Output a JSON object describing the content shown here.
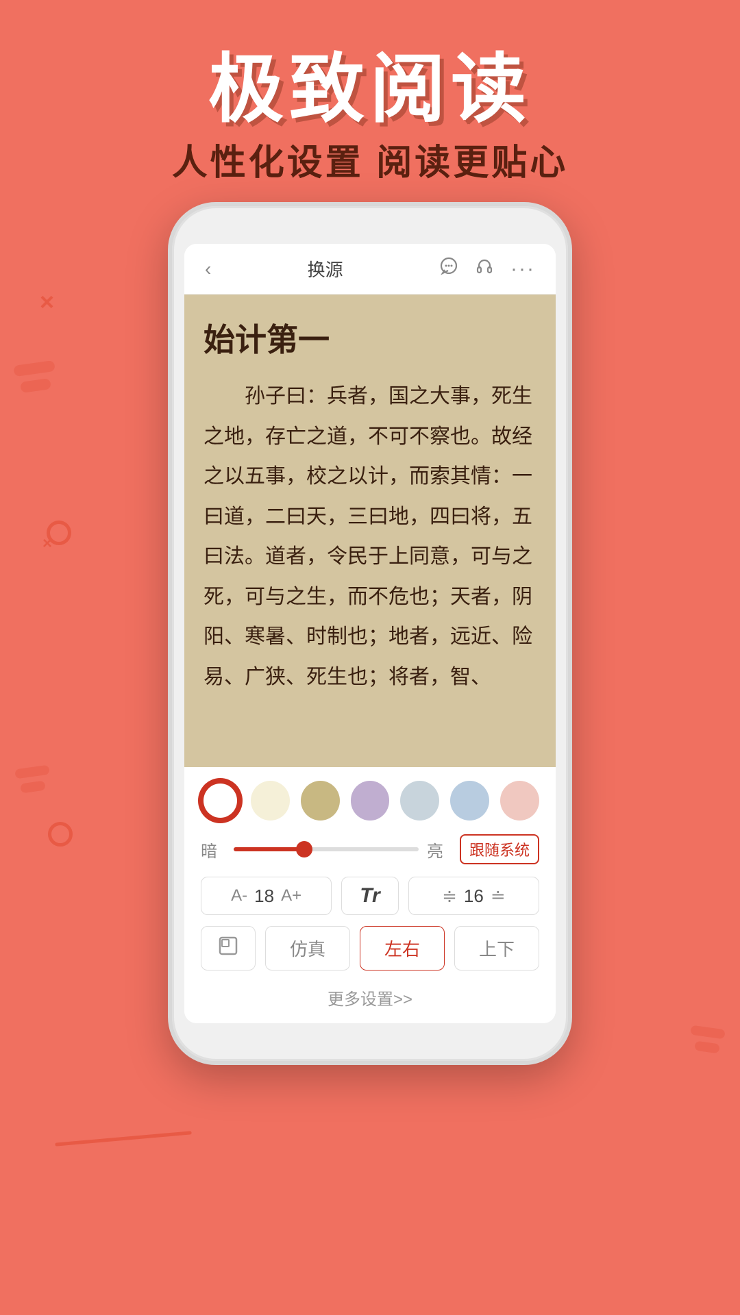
{
  "page": {
    "background_color": "#F07060",
    "main_title": "极致阅读",
    "subtitle": "人性化设置  阅读更贴心"
  },
  "phone": {
    "topbar": {
      "back_label": "‹",
      "title": "换源",
      "chat_icon": "💬",
      "headphone_icon": "🎧",
      "more_icon": "···"
    },
    "book": {
      "chapter_title": "始计第一",
      "content": "孙子曰：兵者，国之大事，死生之地，存亡之道，不可不察也。故经之以五事，校之以计，而索其情：一曰道，二曰天，三曰地，四曰将，五曰法。道者，令民于上同意，可与之死，可与之生，而不危也；天者，阴阳、寒暑、时制也；地者，远近、险易、广狭、死生也；将者，智、"
    },
    "settings": {
      "colors": [
        {
          "id": "white",
          "value": "#FFFFFF",
          "selected": true
        },
        {
          "id": "cream",
          "value": "#F5F0D8",
          "selected": false
        },
        {
          "id": "tan",
          "value": "#C8B882",
          "selected": false
        },
        {
          "id": "lavender",
          "value": "#C0AED0",
          "selected": false
        },
        {
          "id": "light_blue",
          "value": "#C8D4DC",
          "selected": false
        },
        {
          "id": "sky",
          "value": "#B8CCE0",
          "selected": false
        },
        {
          "id": "pink",
          "value": "#F0C8C0",
          "selected": false
        }
      ],
      "brightness": {
        "dark_label": "暗",
        "light_label": "亮",
        "value": 38,
        "follow_system_label": "跟随系统"
      },
      "font_size": {
        "decrease_label": "A-",
        "value": "18",
        "increase_label": "A+"
      },
      "font_type_label": "Tr",
      "line_spacing": {
        "decrease_icon": "≑",
        "value": "16",
        "increase_icon": "≐"
      },
      "page_modes": {
        "scroll_icon": "⧉",
        "simulation_label": "仿真",
        "left_right_label": "左右",
        "up_down_label": "上下"
      },
      "more_settings_label": "更多设置>>"
    }
  },
  "decorations": {
    "x_marks": [
      "×",
      "×",
      "×"
    ],
    "circles": [
      "small",
      "small",
      "large"
    ]
  }
}
